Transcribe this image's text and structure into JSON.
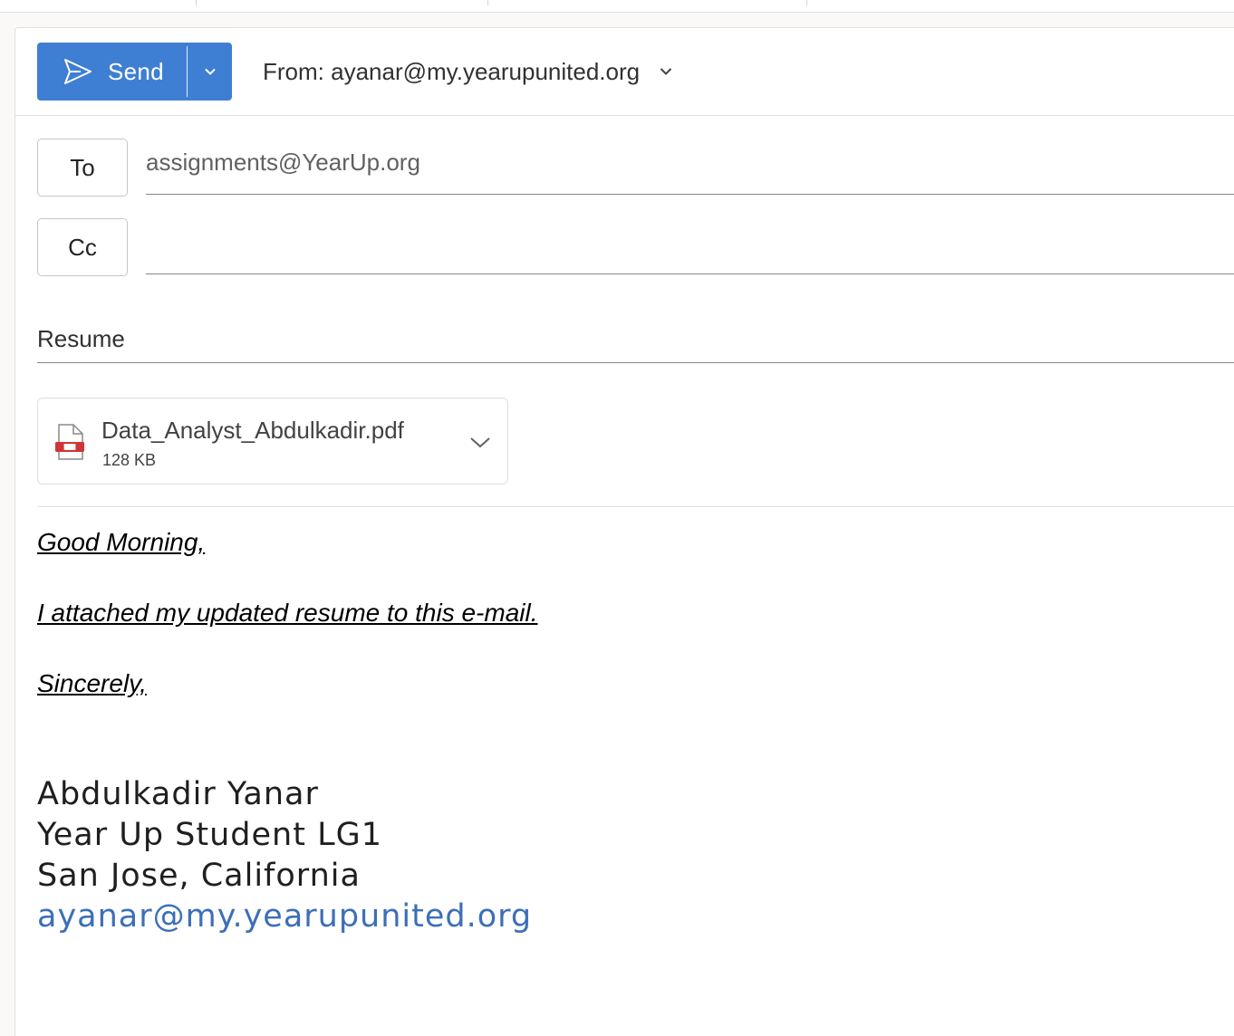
{
  "header": {
    "send_label": "Send",
    "from_text": "From: ayanar@my.yearupunited.org"
  },
  "recipients": {
    "to_label": "To",
    "to_value": "assignments@YearUp.org",
    "cc_label": "Cc",
    "cc_value": ""
  },
  "subject": "Resume",
  "attachment": {
    "file_name": "Data_Analyst_Abdulkadir.pdf",
    "file_size": "128 KB",
    "icon": "pdf-file-icon"
  },
  "body": {
    "greeting": "Good Morning,",
    "message": "I attached my updated resume to this e-mail.",
    "closing": "Sincerely,"
  },
  "signature": {
    "name": "Abdulkadir Yanar",
    "title": "Year Up Student LG1",
    "location": "San Jose, California",
    "email": "ayanar@my.yearupunited.org"
  },
  "colors": {
    "accent": "#3e7fd3",
    "link": "#3c6fb8"
  }
}
